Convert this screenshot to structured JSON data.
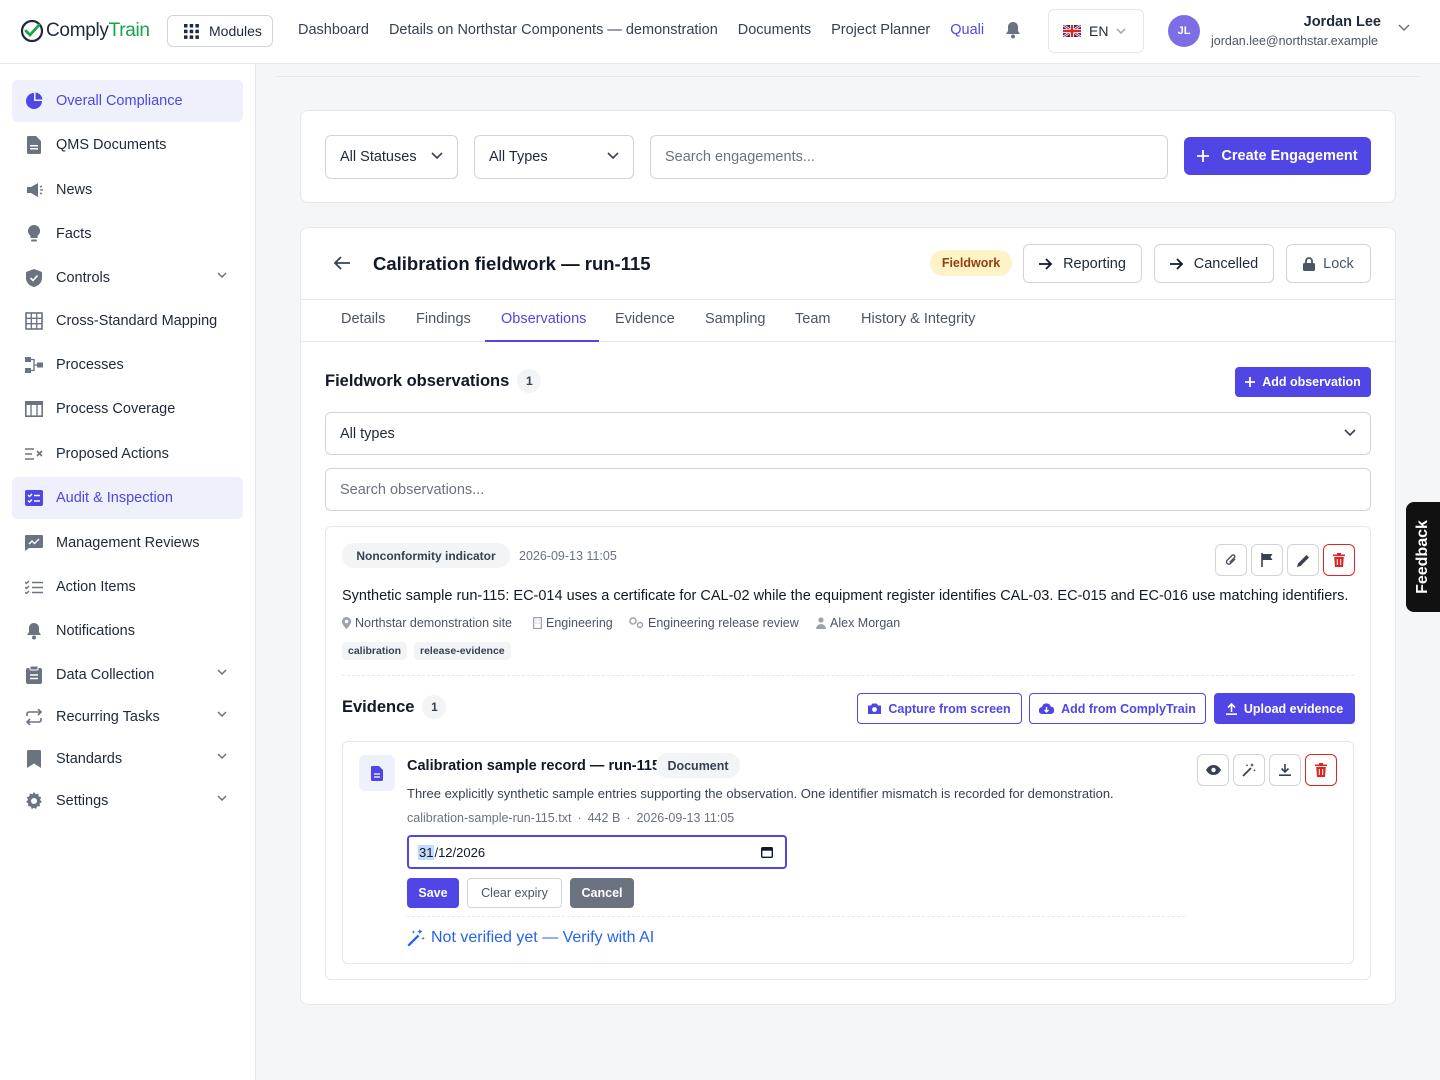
{
  "app": {
    "logo_prefix": "Comply",
    "logo_suffix": "Train"
  },
  "topbar": {
    "modules_label": "Modules",
    "nav": [
      "Dashboard",
      "Details on Northstar Components — demonstration",
      "Documents",
      "Project Planner",
      "Quali"
    ],
    "language": "EN",
    "user_initials": "JL",
    "user_name": "Jordan Lee",
    "user_email": "jordan.lee@northstar.example"
  },
  "sidebar": {
    "items": [
      {
        "label": "Overall Compliance",
        "icon": "pie-chart-icon",
        "active": true
      },
      {
        "label": "QMS Documents",
        "icon": "document-icon"
      },
      {
        "label": "News",
        "icon": "megaphone-icon"
      },
      {
        "label": "Facts",
        "icon": "lightbulb-icon"
      },
      {
        "label": "Controls",
        "icon": "shield-icon",
        "expandable": true
      },
      {
        "label": "Cross-Standard Mapping",
        "icon": "grid-icon"
      },
      {
        "label": "Processes",
        "icon": "process-icon"
      },
      {
        "label": "Process Coverage",
        "icon": "table-icon"
      },
      {
        "label": "Proposed Actions",
        "icon": "list-x-icon"
      },
      {
        "label": "Audit & Inspection",
        "icon": "checklist-icon",
        "active": true
      },
      {
        "label": "Management Reviews",
        "icon": "chart-icon"
      },
      {
        "label": "Action Items",
        "icon": "tasks-icon"
      },
      {
        "label": "Notifications",
        "icon": "bell-icon"
      },
      {
        "label": "Data Collection",
        "icon": "clipboard-icon",
        "expandable": true
      },
      {
        "label": "Recurring Tasks",
        "icon": "repeat-icon",
        "expandable": true
      },
      {
        "label": "Standards",
        "icon": "bookmark-icon",
        "expandable": true
      },
      {
        "label": "Settings",
        "icon": "gear-icon",
        "expandable": true
      }
    ]
  },
  "filters": {
    "status": "All Statuses",
    "type": "All Types",
    "search_placeholder": "Search engagements...",
    "create_label": "Create Engagement"
  },
  "engagement": {
    "title": "Calibration fieldwork — run-115",
    "status_badge": "Fieldwork",
    "actions": {
      "reporting": "Reporting",
      "cancelled": "Cancelled",
      "lock": "Lock"
    },
    "tabs": [
      "Details",
      "Findings",
      "Observations",
      "Evidence",
      "Sampling",
      "Team",
      "History & Integrity"
    ],
    "active_tab": "Observations"
  },
  "observations": {
    "heading": "Fieldwork observations",
    "count": "1",
    "add_label": "Add observation",
    "type_filter": "All types",
    "search_placeholder": "Search observations...",
    "item": {
      "type": "Nonconformity indicator",
      "timestamp": "2026-09-13 11:05",
      "text": "Synthetic sample run-115: EC-014 uses a certificate for CAL-02 while the equipment register identifies CAL-03. EC-015 and EC-016 use matching identifiers.",
      "site": "Northstar demonstration site",
      "department": "Engineering",
      "process": "Engineering release review",
      "owner": "Alex Morgan",
      "tags": [
        "calibration",
        "release-evidence"
      ]
    }
  },
  "evidence": {
    "heading": "Evidence",
    "count": "1",
    "capture_label": "Capture from screen",
    "add_from_label": "Add from ComplyTrain",
    "upload_label": "Upload evidence",
    "item": {
      "title": "Calibration sample record — run-115",
      "kind": "Document",
      "description": "Three explicitly synthetic sample entries supporting the observation. One identifier mismatch is recorded for demonstration.",
      "filename": "calibration-sample-run-115.txt",
      "size": "442 B",
      "date": "2026-09-13 11:05",
      "expiry_day": "31",
      "expiry_rest": "/12/2026",
      "save_label": "Save",
      "clear_label": "Clear expiry",
      "cancel_label": "Cancel",
      "verify_label": "Not verified yet — Verify with AI"
    }
  },
  "feedback_label": "Feedback"
}
